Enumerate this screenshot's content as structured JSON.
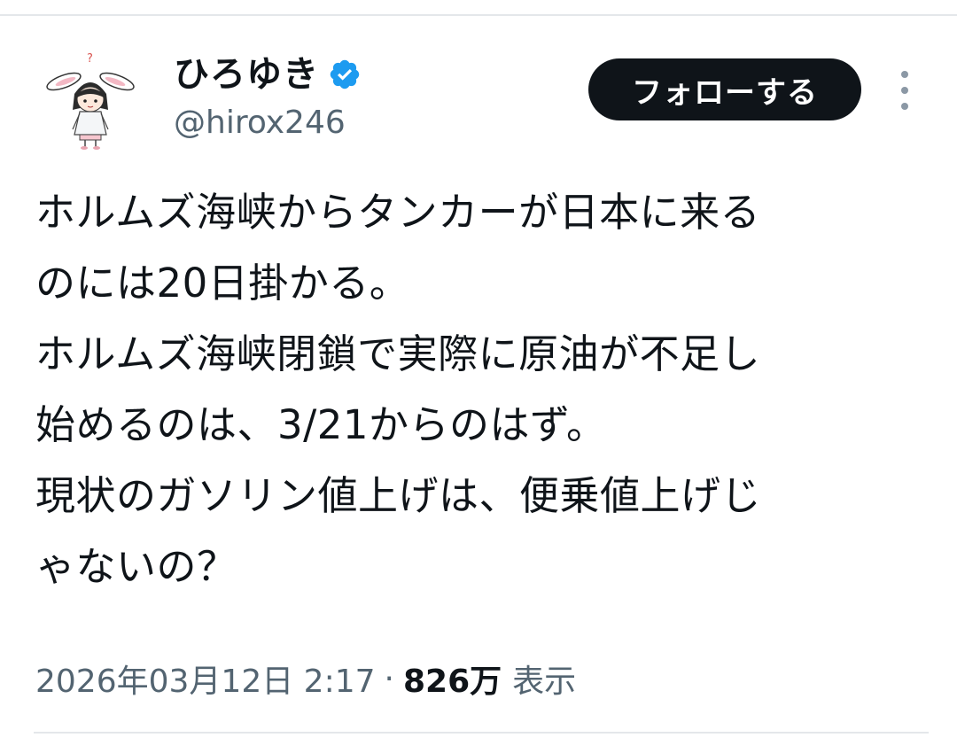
{
  "user": {
    "display_name": "ひろゆき",
    "handle": "@hirox246",
    "verified": true
  },
  "follow_button": {
    "label": "フォローする"
  },
  "tweet": {
    "lines": [
      "ホルムズ海峡からタンカーが日本に来る",
      "のには20日掛かる。",
      "ホルムズ海峡閉鎖で実際に原油が不足し",
      "始めるのは、3/21からのはず。",
      "現状のガソリン値上げは、便乗値上げじ",
      "ゃないの？"
    ]
  },
  "meta": {
    "timestamp": "2026年03月12日 2:17",
    "separator": "·",
    "views_count": "826万",
    "views_label": "表示"
  },
  "colors": {
    "text": "#0f1419",
    "secondary": "#536471",
    "verified": "#1d9bf0",
    "follow_bg": "#0f1419",
    "divider": "#e4e7ea"
  },
  "icons": {
    "verified": "verified-badge-icon",
    "more": "more-vertical-icon",
    "avatar": "avatar-illustration"
  }
}
